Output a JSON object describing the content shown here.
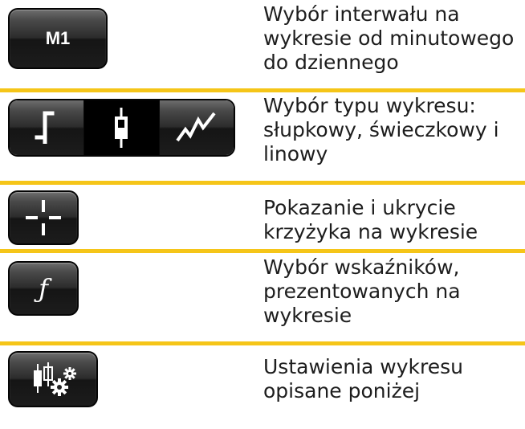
{
  "rows": [
    {
      "button": {
        "label": "M1",
        "icon": "timeframe-button"
      },
      "description": "Wybór interwału na\nwykresie od minutowego\ndo dziennego"
    },
    {
      "button": {
        "segments": [
          {
            "icon": "bar-chart-icon",
            "selected": false
          },
          {
            "icon": "candlestick-chart-icon",
            "selected": true
          },
          {
            "icon": "line-chart-icon",
            "selected": false
          }
        ]
      },
      "description": "Wybór typu wykresu:\nsłupkowy, świeczkowy i\nlinowy"
    },
    {
      "button": {
        "icon": "crosshair-icon"
      },
      "description": "Pokazanie i ukrycie\nkrzyżyka na wykresie"
    },
    {
      "button": {
        "icon": "function-f-icon",
        "glyph": "ƒ"
      },
      "description": "Wybór wskaźników,\nprezentowanych na\nwykresie"
    },
    {
      "button": {
        "icon": "chart-settings-gear-icon"
      },
      "description": "Ustawienia wykresu\nopisane poniżej"
    }
  ],
  "colors": {
    "separator": "#f5c518",
    "button_dark": "#1c1c1c",
    "text": "#1d1d1d"
  }
}
